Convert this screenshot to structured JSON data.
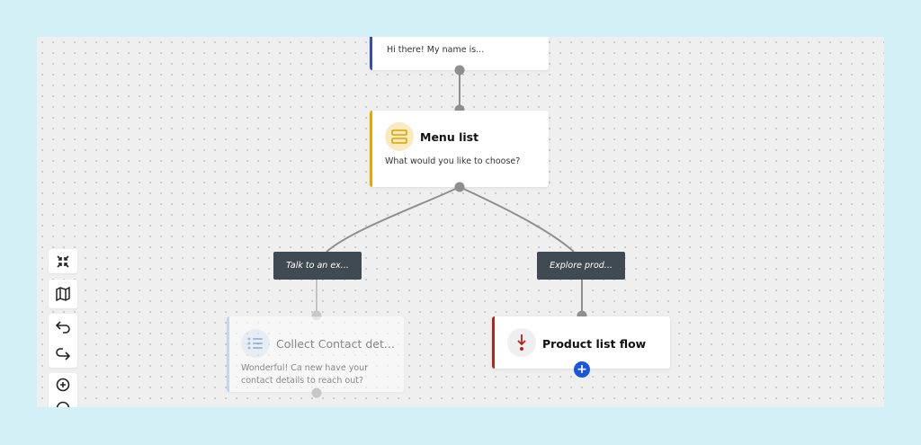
{
  "nodes": {
    "greeting": {
      "text": "Hi there! My name is..."
    },
    "menu_list": {
      "title": "Menu list",
      "text": "What would you like to choose?",
      "accent": "#e0a800"
    },
    "collect_contact": {
      "title": "Collect Contact det...",
      "text": "Wonderful! Ca new have your contact details to reach out?",
      "accent": "#9ec3ee"
    },
    "product_list": {
      "title": "Product list flow",
      "accent": "#b3261e"
    }
  },
  "branches": {
    "talk": "Talk to an ex...",
    "explore": "Explore prod..."
  },
  "toolbar": {
    "icons": [
      "collapse-icon",
      "map-icon",
      "undo-icon",
      "redo-icon",
      "zoom-in-icon",
      "zoom-out-icon"
    ]
  },
  "colors": {
    "page_background": "#d3f0f7",
    "canvas_background": "#efefef",
    "greeting_accent": "#2f4fb5",
    "label_background": "#3f4a52",
    "add_button": "#1a56db",
    "connector": "#8f8f8f"
  }
}
